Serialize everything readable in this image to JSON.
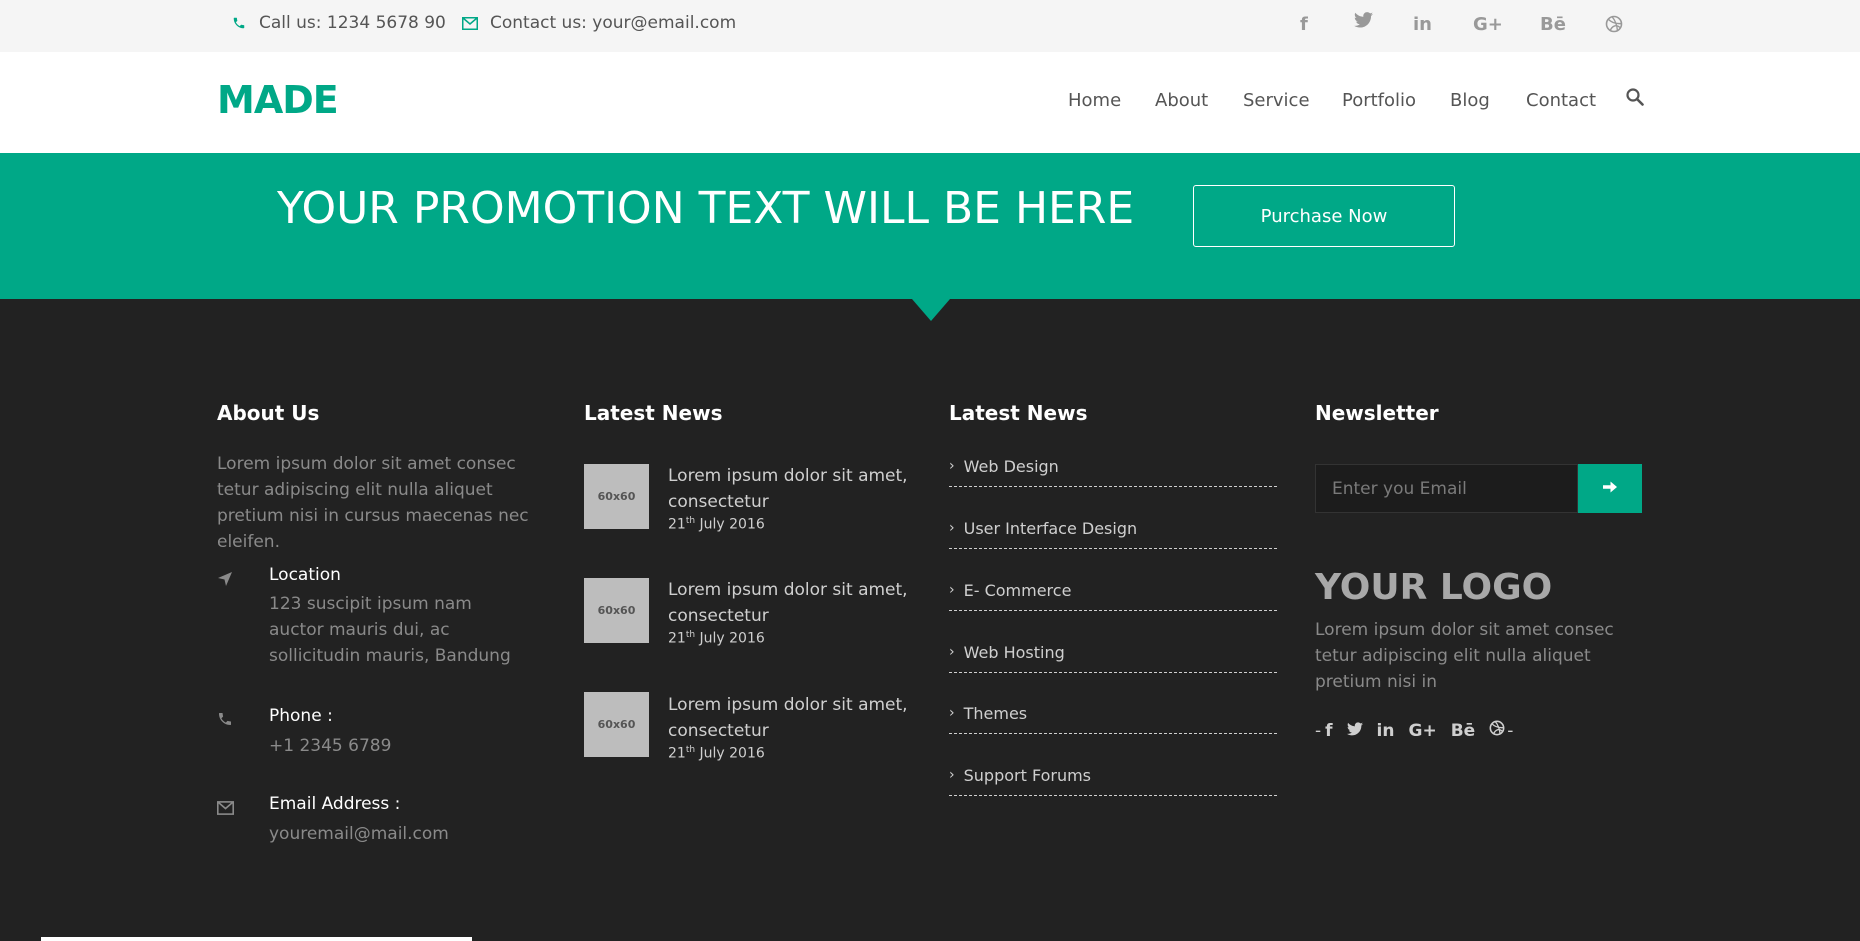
{
  "colors": {
    "accent": "#00a887",
    "footer_bg": "#222222",
    "topbar_bg": "#f5f5f5"
  },
  "topbar": {
    "phone": "Call us: 1234 5678 90",
    "email": "Contact us: your@email.com",
    "social": [
      {
        "icon": "facebook-icon",
        "glyph": "f"
      },
      {
        "icon": "twitter-icon",
        "glyph": "🐦"
      },
      {
        "icon": "linkedin-icon",
        "glyph": "in"
      },
      {
        "icon": "google-plus-icon",
        "glyph": "G+"
      },
      {
        "icon": "behance-icon",
        "glyph": "Bē"
      },
      {
        "icon": "dribbble-icon",
        "glyph": "⊛"
      }
    ]
  },
  "nav": {
    "brand": "MADE",
    "items": [
      "Home",
      "About",
      "Service",
      "Portfolio",
      "Blog",
      "Contact"
    ]
  },
  "promo": {
    "text": "YOUR PROMOTION TEXT WILL BE HERE",
    "button": "Purchase Now"
  },
  "footer": {
    "about": {
      "title": "About Us",
      "text": "Lorem ipsum dolor sit amet consec tetur adipiscing elit nulla aliquet pretium nisi in cursus maecenas nec eleifen.",
      "location_label": "Location",
      "location_value": "123 suscipit ipsum nam auctor mauris dui, ac sollicitudin mauris, Bandung",
      "phone_label": "Phone :",
      "phone_value": "+1 2345 6789",
      "email_label": "Email Address :",
      "email_value": "youremail@mail.com"
    },
    "news": {
      "title": "Latest News",
      "items": [
        {
          "thumb": "60x60",
          "title": "Lorem ipsum dolor sit amet, consectetur",
          "day": "21",
          "suffix": "th",
          "date": " July 2016"
        },
        {
          "thumb": "60x60",
          "title": "Lorem ipsum dolor sit amet, consectetur",
          "day": "21",
          "suffix": "th",
          "date": " July 2016"
        },
        {
          "thumb": "60x60",
          "title": "Lorem ipsum dolor sit amet, consectetur",
          "day": "21",
          "suffix": "th",
          "date": " July 2016"
        }
      ]
    },
    "links": {
      "title": "Latest News",
      "items": [
        "Web Design",
        "User Interface Design",
        "E- Commerce",
        "Web Hosting",
        "Themes",
        "Support Forums"
      ]
    },
    "newsletter": {
      "title": "Newsletter",
      "placeholder": "Enter you Email",
      "logo": "YOUR LOGO",
      "text": "Lorem ipsum dolor sit amet consec tetur adipiscing elit nulla aliquet pretium nisi in",
      "dash": "-"
    }
  }
}
